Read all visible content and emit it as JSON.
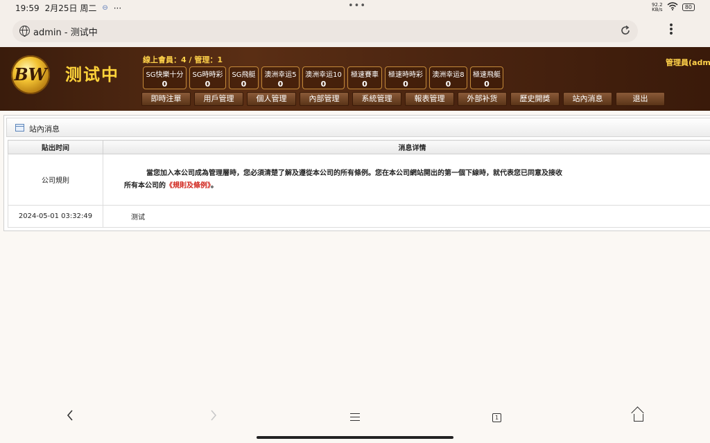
{
  "status_bar": {
    "time": "19:59",
    "date": "2月25日 周二",
    "network_speed_value": "92.2",
    "network_speed_unit": "KB/s",
    "battery": "80"
  },
  "browser": {
    "url_text": "admin - 测试中",
    "reload_icon": "reload-icon",
    "menu_icon": "more-vertical-icon"
  },
  "header": {
    "logo_text": "BW",
    "site_title": "测试中",
    "online_info": "線上會員：4 / 管理：1",
    "admin_label": "管理員(admin)",
    "games": [
      {
        "name": "SG快樂十分",
        "count": "0"
      },
      {
        "name": "SG時時彩",
        "count": "0"
      },
      {
        "name": "SG飛艇",
        "count": "0"
      },
      {
        "name": "澳洲幸运5",
        "count": "0"
      },
      {
        "name": "澳洲幸运10",
        "count": "0"
      },
      {
        "name": "極速賽車",
        "count": "0"
      },
      {
        "name": "極速時時彩",
        "count": "0"
      },
      {
        "name": "澳洲幸运8",
        "count": "0"
      },
      {
        "name": "極速飛艇",
        "count": "0"
      }
    ],
    "nav": [
      "即時注單",
      "用戶管理",
      "個人管理",
      "內部管理",
      "系統管理",
      "報表管理",
      "外部补货",
      "歷史開獎",
      "站內消息",
      "退出"
    ]
  },
  "panel": {
    "title": "站內消息",
    "columns": [
      "貼出时间",
      "消息详情"
    ],
    "rows": [
      {
        "time": "公司規則",
        "text_before": "當您加入本公司成為管理層時，您必須清楚了解及遵從本公司的所有條例。您在本公司網站開出的第一個下線時，就代表您已同意及接收所有本公司的",
        "link": "《規則及條例》",
        "text_after": "。"
      },
      {
        "time": "2024-05-01 03:32:49",
        "text": "测试"
      }
    ]
  },
  "bottom_nav": {
    "tab_count": "1"
  }
}
